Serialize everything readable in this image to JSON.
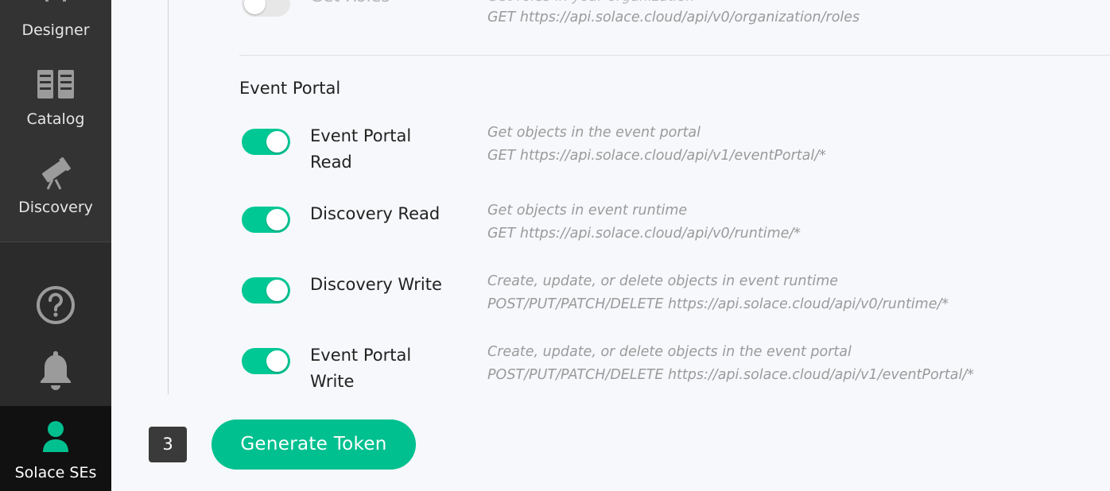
{
  "sidebar": {
    "items": [
      {
        "label": "Designer",
        "icon": "designer-icon"
      },
      {
        "label": "Catalog",
        "icon": "catalog-icon"
      },
      {
        "label": "Discovery",
        "icon": "discovery-icon"
      }
    ],
    "help_icon": "help-icon",
    "notifications_icon": "bell-icon",
    "user": {
      "label": "Solace SEs",
      "icon": "user-icon"
    }
  },
  "partial_row": {
    "label": "Get Roles",
    "desc1": "Get roles in your organization",
    "desc2": "GET https://api.solace.cloud/api/v0/organization/roles",
    "enabled": false
  },
  "section": {
    "title": "Event Portal",
    "permissions": [
      {
        "label1": "Event Portal",
        "label2": "Read",
        "desc1": "Get objects in the event portal",
        "desc2": "GET https://api.solace.cloud/api/v1/eventPortal/*",
        "enabled": true
      },
      {
        "label1": "Discovery Read",
        "label2": "",
        "desc1": "Get objects in event runtime",
        "desc2": "GET https://api.solace.cloud/api/v0/runtime/*",
        "enabled": true
      },
      {
        "label1": "Discovery Write",
        "label2": "",
        "desc1": "Create, update, or delete objects in event runtime",
        "desc2": "POST/PUT/PATCH/DELETE https://api.solace.cloud/api/v0/runtime/*",
        "enabled": true
      },
      {
        "label1": "Event Portal",
        "label2": "Write",
        "desc1": "Create, update, or delete objects in the event portal",
        "desc2": "POST/PUT/PATCH/DELETE https://api.solace.cloud/api/v1/eventPortal/*",
        "enabled": true
      }
    ]
  },
  "footer": {
    "step": "3",
    "generate_label": "Generate Token"
  },
  "colors": {
    "accent": "#00c08f",
    "toggle_on": "#00c895",
    "sidebar_bg": "#2b2b2b"
  }
}
